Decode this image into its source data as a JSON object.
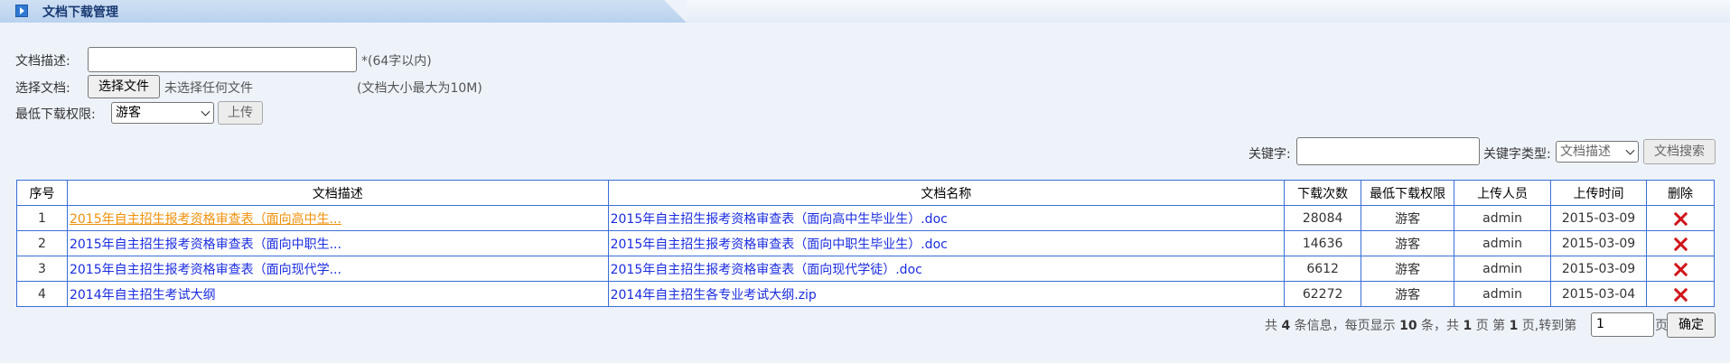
{
  "header": {
    "title": "文档下载管理"
  },
  "form": {
    "desc_label": "文档描述:",
    "desc_hint": "*(64字以内)",
    "file_label": "选择文档:",
    "file_button": "选择文件",
    "file_status": "未选择任何文件",
    "size_hint": "(文档大小最大为10M)",
    "perm_label": "最低下载权限:",
    "perm_value": "游客",
    "upload_button": "上传"
  },
  "search": {
    "keyword_label": "关键字:",
    "type_label": "关键字类型:",
    "type_value": "文档描述",
    "search_button": "文档搜索"
  },
  "table": {
    "headers": [
      "序号",
      "文档描述",
      "文档名称",
      "下载次数",
      "最低下载权限",
      "上传人员",
      "上传时间",
      "删除"
    ],
    "rows": [
      {
        "no": "1",
        "desc": "2015年自主招生报考资格审查表（面向高中生...",
        "name": "2015年自主招生报考资格审查表（面向高中生毕业生）.doc",
        "downloads": "28084",
        "perm": "游客",
        "uploader": "admin",
        "date": "2015-03-09"
      },
      {
        "no": "2",
        "desc": "2015年自主招生报考资格审查表（面向中职生...",
        "name": "2015年自主招生报考资格审查表（面向中职生毕业生）.doc",
        "downloads": "14636",
        "perm": "游客",
        "uploader": "admin",
        "date": "2015-03-09"
      },
      {
        "no": "3",
        "desc": "2015年自主招生报考资格审查表（面向现代学...",
        "name": "2015年自主招生报考资格审查表（面向现代学徒）.doc",
        "downloads": "6612",
        "perm": "游客",
        "uploader": "admin",
        "date": "2015-03-09"
      },
      {
        "no": "4",
        "desc": "2014年自主招生考试大纲",
        "name": "2014年自主招生各专业考试大纲.zip",
        "downloads": "62272",
        "perm": "游客",
        "uploader": "admin",
        "date": "2015-03-04"
      }
    ]
  },
  "pager": {
    "t1": "共 ",
    "total": "4",
    "t2": " 条信息，每页显示 ",
    "per_page": "10",
    "t3": " 条，共 ",
    "pages": "1",
    "t4": " 页 第 ",
    "current": "1",
    "t5": " 页,转到第",
    "goto_value": "1",
    "suffix": "页",
    "ok_button": "确定"
  },
  "colors": {
    "link": "#1a2ce0",
    "visited_link": "#f0900a",
    "table_border": "#3a6fd8",
    "delete": "#d0161b"
  }
}
